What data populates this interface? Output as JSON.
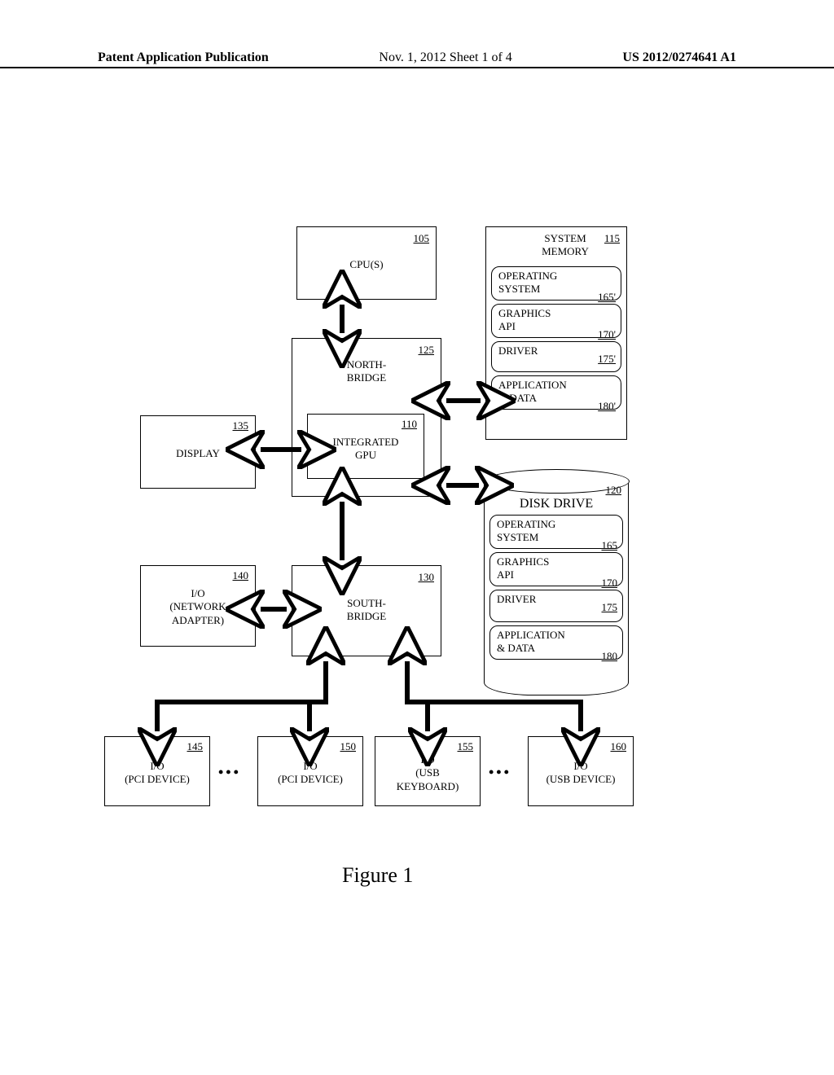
{
  "header": {
    "left": "Patent Application Publication",
    "center": "Nov. 1, 2012   Sheet 1 of 4",
    "right": "US 2012/0274641 A1"
  },
  "figure_caption": "Figure 1",
  "blocks": {
    "cpu": {
      "ref": "105",
      "label": "CPU(S)"
    },
    "northbridge": {
      "ref": "125",
      "label": "NORTH-\nBRIDGE"
    },
    "igpu": {
      "ref": "110",
      "label": "INTEGRATED\nGPU"
    },
    "display": {
      "ref": "135",
      "label": "DISPLAY"
    },
    "southbridge": {
      "ref": "130",
      "label": "SOUTH-\nBRIDGE"
    },
    "io_net": {
      "ref": "140",
      "label": "I/O\n(NETWORK\nADAPTER)"
    },
    "sysmem": {
      "ref": "115",
      "label": "SYSTEM\nMEMORY",
      "items": [
        {
          "label": "OPERATING\nSYSTEM",
          "ref": "165'"
        },
        {
          "label": "GRAPHICS\nAPI",
          "ref": "170'"
        },
        {
          "label": "DRIVER",
          "ref": "175'"
        },
        {
          "label": "APPLICATION\n& DATA",
          "ref": "180'"
        }
      ]
    },
    "disk": {
      "ref": "120",
      "label": "DISK DRIVE",
      "items": [
        {
          "label": "OPERATING\nSYSTEM",
          "ref": "165"
        },
        {
          "label": "GRAPHICS\nAPI",
          "ref": "170"
        },
        {
          "label": "DRIVER",
          "ref": "175"
        },
        {
          "label": "APPLICATION\n& DATA",
          "ref": "180"
        }
      ]
    },
    "io_pci1": {
      "ref": "145",
      "label": "I/O\n(PCI DEVICE)"
    },
    "io_pci2": {
      "ref": "150",
      "label": "I/O\n(PCI DEVICE)"
    },
    "io_usbkb": {
      "ref": "155",
      "label": "I/O\n(USB\nKEYBOARD)"
    },
    "io_usb": {
      "ref": "160",
      "label": "I/O\n(USB DEVICE)"
    }
  }
}
